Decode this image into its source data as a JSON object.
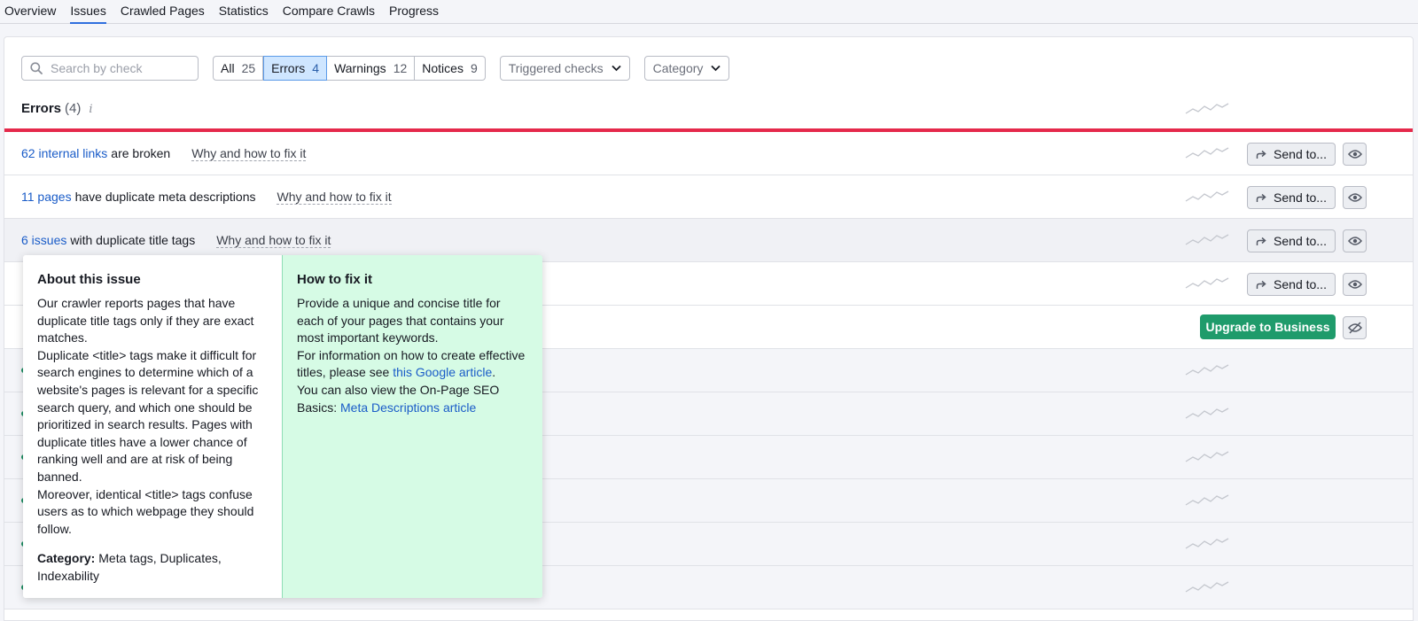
{
  "nav": {
    "tabs": [
      {
        "label": "Overview"
      },
      {
        "label": "Issues"
      },
      {
        "label": "Crawled Pages"
      },
      {
        "label": "Statistics"
      },
      {
        "label": "Compare Crawls"
      },
      {
        "label": "Progress"
      }
    ],
    "active_tab": "Issues"
  },
  "toolbar": {
    "search_placeholder": "Search by check",
    "filters": [
      {
        "label": "All",
        "count": "25"
      },
      {
        "label": "Errors",
        "count": "4"
      },
      {
        "label": "Warnings",
        "count": "12"
      },
      {
        "label": "Notices",
        "count": "9"
      }
    ],
    "selected_filter": "Errors",
    "dropdowns": {
      "triggered": "Triggered checks",
      "category": "Category"
    }
  },
  "section": {
    "title": "Errors",
    "count": "(4)",
    "info_icon": "i"
  },
  "rows": [
    {
      "link": "62 internal links",
      "text": "are broken",
      "why": "Why and how to fix it",
      "send": "Send to..."
    },
    {
      "link": "11 pages",
      "text": "have duplicate meta descriptions",
      "why": "Why and how to fix it",
      "send": "Send to..."
    },
    {
      "link": "6 issues",
      "text": "with duplicate title tags",
      "why": "Why and how to fix it",
      "send": "Send to..."
    },
    {
      "send": "Send to..."
    },
    {
      "upgrade": "Upgrade to Business"
    }
  ],
  "popover": {
    "about_title": "About this issue",
    "about_p1": "Our crawler reports pages that have duplicate title tags only if they are exact matches.",
    "about_p2": "Duplicate <title> tags make it difficult for search engines to determine which of a website's pages is relevant for a specific search query, and which one should be prioritized in search results. Pages with duplicate titles have a lower chance of ranking well and are at risk of being banned.",
    "about_p3": "Moreover, identical <title> tags confuse users as to which webpage they should follow.",
    "category_label": "Category:",
    "category_value": "Meta tags, Duplicates, Indexability",
    "fix_title": "How to fix it",
    "fix_p1": "Provide a unique and concise title for each of your pages that contains your most important keywords.",
    "fix_p2_pre": "For information on how to create effective titles, please see",
    "fix_p2_link": "this Google article",
    "fix_p2_post": ".",
    "fix_p3_pre": "You can also view the On-Page SEO Basics:",
    "fix_p3_link": "Meta Descriptions article"
  },
  "colors": {
    "accent": "#2f6fde",
    "error": "#e5294b",
    "link": "#1a5cc8",
    "upgrade": "#1f9b6b",
    "fix_bg": "#d6fbe5"
  }
}
